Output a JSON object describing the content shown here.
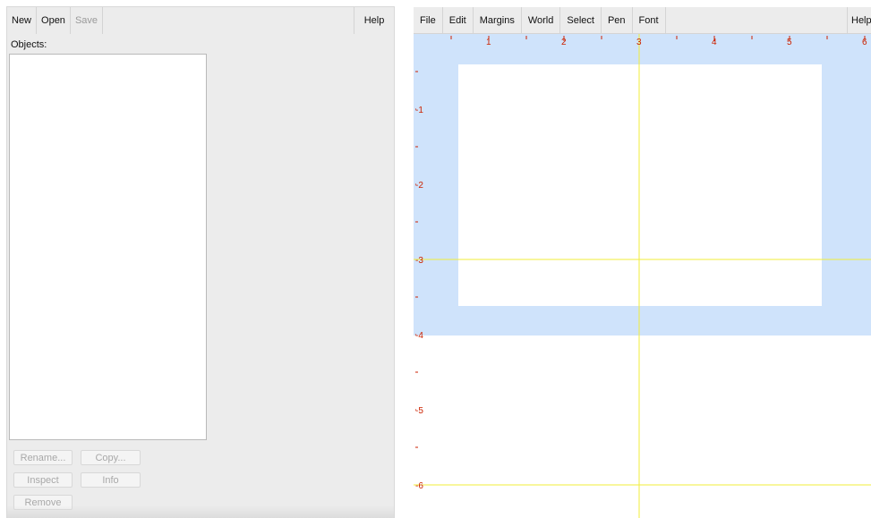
{
  "objects_window": {
    "menu": {
      "new": "New",
      "open": "Open",
      "save": "Save",
      "help": "Help"
    },
    "objects_label": "Objects:",
    "buttons": {
      "rename": "Rename...",
      "copy": "Copy...",
      "inspect": "Inspect",
      "info": "Info",
      "remove": "Remove"
    }
  },
  "picture_window": {
    "menu": {
      "file": "File",
      "edit": "Edit",
      "margins": "Margins",
      "world": "World",
      "select": "Select",
      "pen": "Pen",
      "font": "Font",
      "help": "Help"
    },
    "ruler_top_labels": [
      "1",
      "2",
      "3",
      "4",
      "5",
      "6"
    ],
    "ruler_left_labels": [
      "-1",
      "-2",
      "-3",
      "-4",
      "-5",
      "-6"
    ],
    "colors": {
      "margin_area": "#cfe3fb",
      "ruler_text": "#cc2200",
      "crosshair": "#f2ee3a"
    }
  }
}
